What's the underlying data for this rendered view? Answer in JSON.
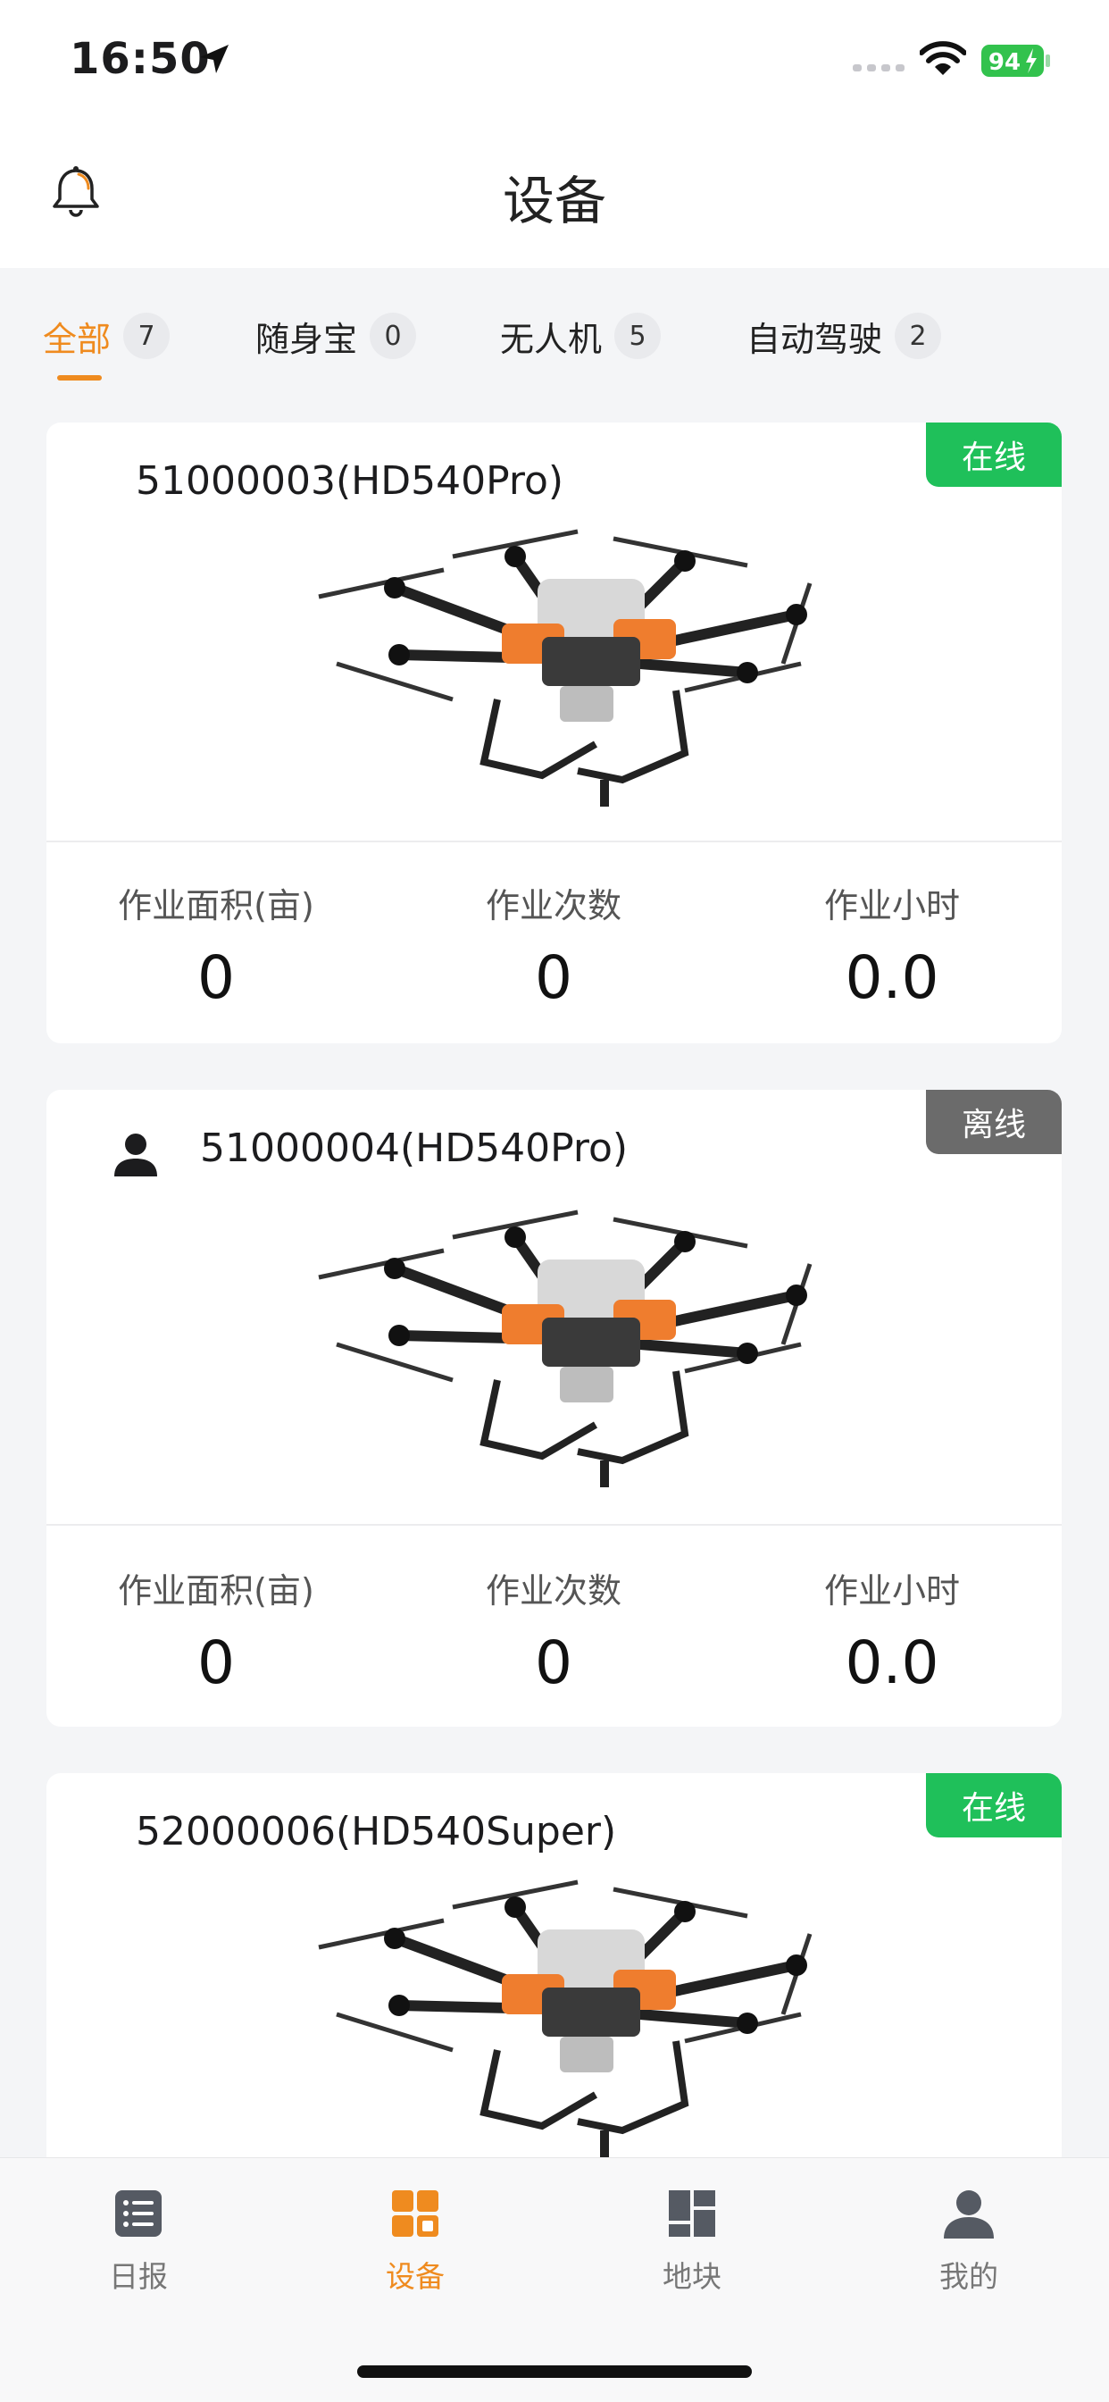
{
  "status_bar": {
    "time": "16:50",
    "battery": "94"
  },
  "header": {
    "title": "设备"
  },
  "tabs": [
    {
      "label": "全部",
      "count": "7",
      "active": true
    },
    {
      "label": "随身宝",
      "count": "0"
    },
    {
      "label": "无人机",
      "count": "5"
    },
    {
      "label": "自动驾驶",
      "count": "2"
    }
  ],
  "devices": [
    {
      "name": "51000003(HD540Pro)",
      "status": "在线",
      "stats": [
        {
          "label": "作业面积(亩)",
          "value": "0"
        },
        {
          "label": "作业次数",
          "value": "0"
        },
        {
          "label": "作业小时",
          "value": "0.0"
        }
      ]
    },
    {
      "name": "51000004(HD540Pro)",
      "status": "离线",
      "stats": [
        {
          "label": "作业面积(亩)",
          "value": "0"
        },
        {
          "label": "作业次数",
          "value": "0"
        },
        {
          "label": "作业小时",
          "value": "0.0"
        }
      ]
    },
    {
      "name": "52000006(HD540Super)",
      "status": "在线"
    }
  ],
  "nav": [
    {
      "label": "日报",
      "icon": "list-icon"
    },
    {
      "label": "设备",
      "icon": "device-grid-icon",
      "active": true
    },
    {
      "label": "地块",
      "icon": "field-block-icon"
    },
    {
      "label": "我的",
      "icon": "profile-icon"
    }
  ],
  "colors": {
    "accent": "#ef8b1f",
    "online": "#1fc05a",
    "offline": "#6b6b6b"
  }
}
